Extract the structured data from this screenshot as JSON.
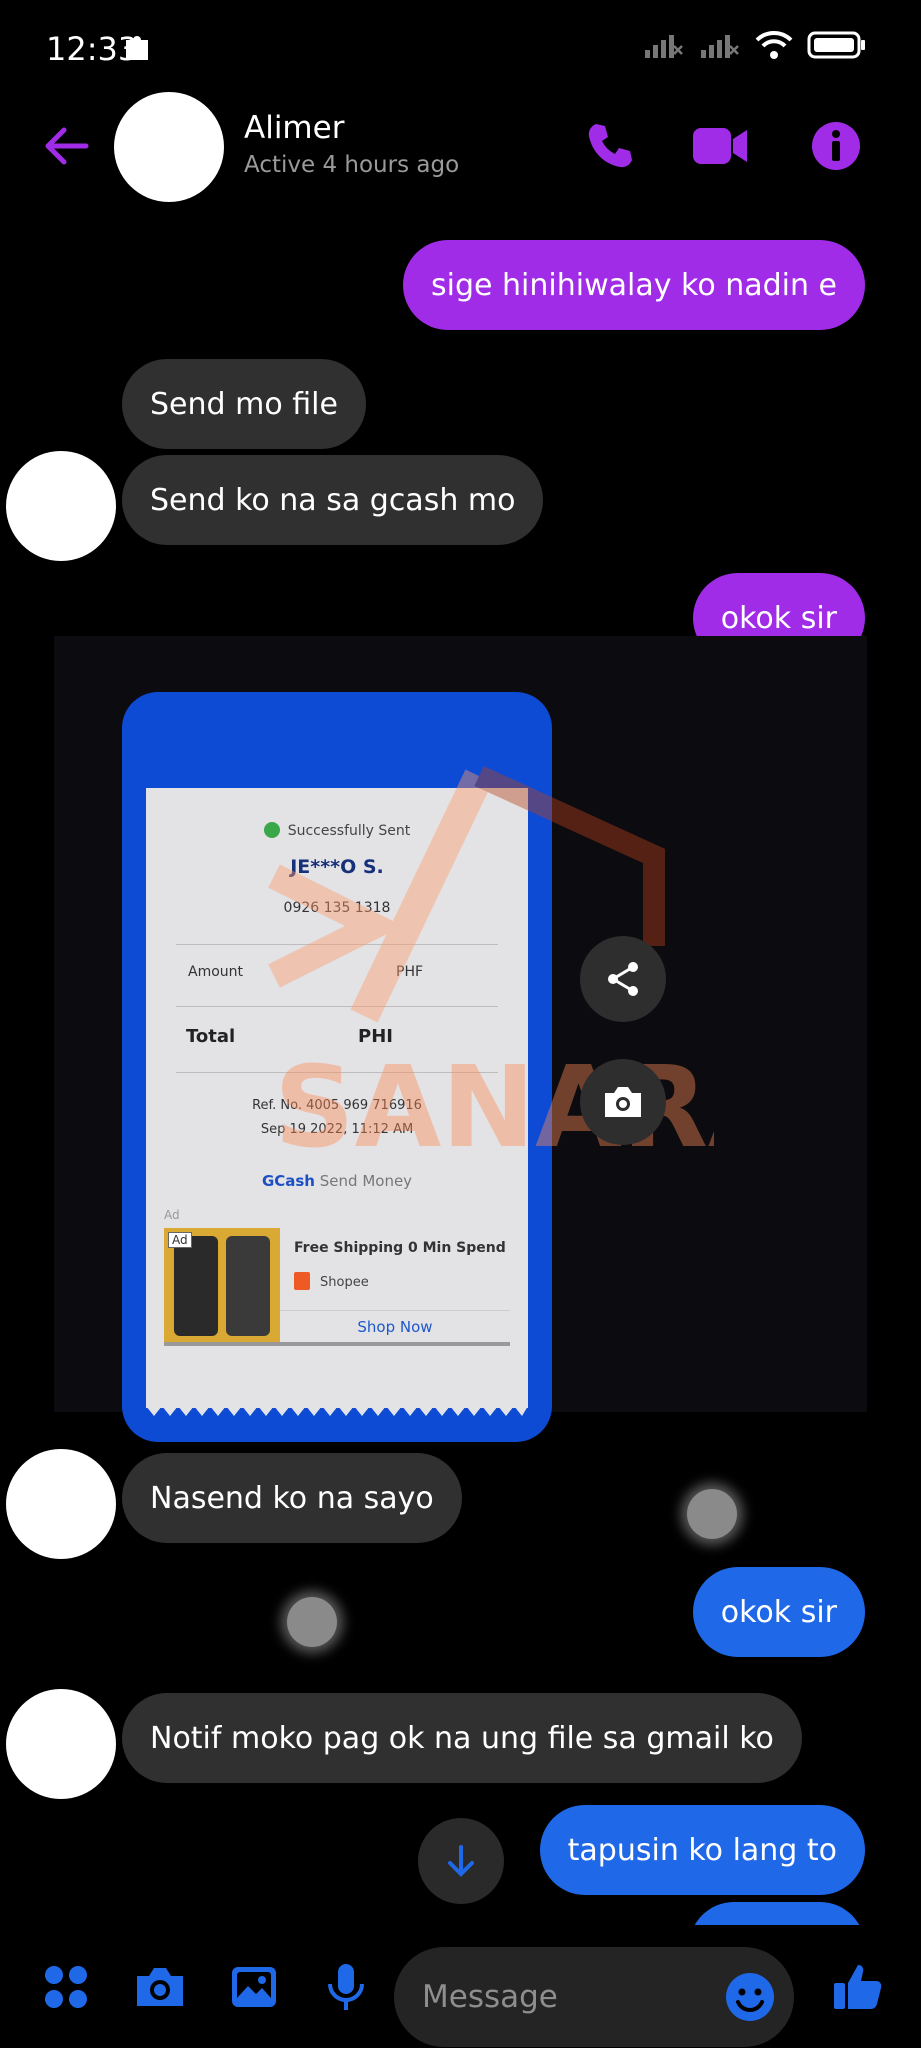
{
  "status_bar": {
    "time": "12:33"
  },
  "header": {
    "contact_name": "Alimer",
    "contact_status": "Active 4 hours ago"
  },
  "messages": [
    {
      "text": "sige hinihiwalay ko nadin e"
    },
    {
      "text": "Send mo file"
    },
    {
      "text": "Send ko na sa gcash mo"
    },
    {
      "text": "okok sir"
    },
    {
      "text": "Nasend ko na sayo"
    },
    {
      "text": "okok sir"
    },
    {
      "text": "Notif moko pag ok na ung file sa gmail ko"
    },
    {
      "text": "tapusin ko lang to"
    }
  ],
  "receipt": {
    "status": "Successfully Sent",
    "recipient": "JE***O S.",
    "phone": "0926 135 1318",
    "amount_label": "Amount",
    "amount_value": "PHF",
    "total_label": "Total",
    "total_value": "PHI",
    "ref": "Ref. No. 4005 969 716916",
    "date": "Sep 19 2022, 11:12 AM",
    "brand": "GCash",
    "brand_suffix": "Send Money",
    "ad_label": "Ad",
    "ad_tag": "Ad",
    "ad_title": "Free Shipping 0 Min Spend",
    "ad_shop": "Shopee",
    "ad_cta": "Shop Now",
    "watermark": "SANARA"
  },
  "composer": {
    "placeholder": "Message"
  },
  "colors": {
    "accent_purple": "#a12ce8",
    "accent_blue": "#1f68e8",
    "incoming_bubble": "#303030",
    "background": "#000000"
  },
  "icons": [
    "back-arrow-icon",
    "phone-icon",
    "video-icon",
    "info-icon",
    "share-icon",
    "camera-icon",
    "arrow-down-icon",
    "apps-icon",
    "gallery-icon",
    "mic-icon",
    "emoji-icon",
    "thumbs-up-icon"
  ]
}
